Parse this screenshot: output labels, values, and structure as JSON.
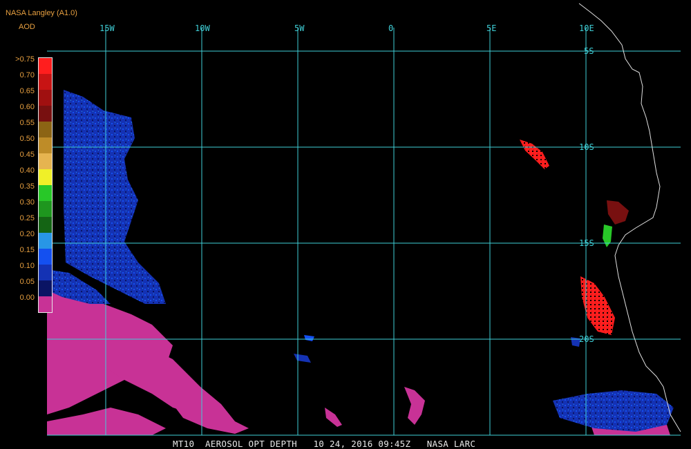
{
  "header": {
    "title": "NASA Langley (A1.0)",
    "subtitle": "AOD"
  },
  "legend": {
    "labels": [
      ">0.75",
      "0.70",
      "0.65",
      "0.60",
      "0.55",
      "0.50",
      "0.45",
      "0.40",
      "0.35",
      "0.30",
      "0.25",
      "0.20",
      "0.15",
      "0.10",
      "0.05",
      "0.00"
    ],
    "colors": [
      "#ff1e1e",
      "#c81414",
      "#a01010",
      "#781010",
      "#8c6414",
      "#be8c28",
      "#e6b450",
      "#f0f028",
      "#28c828",
      "#1e961e",
      "#146414",
      "#2896e6",
      "#1450f0",
      "#1432b4",
      "#0a1464",
      "#c83296"
    ]
  },
  "map": {
    "longitude_labels": [
      "15W",
      "10W",
      "5W",
      "0",
      "5E",
      "10E"
    ],
    "latitude_labels": [
      "5S",
      "10S",
      "15S",
      "20S"
    ],
    "grid_color": "#40d0d8",
    "coast_color": "#e0e0e0"
  },
  "footer": {
    "text": "MT10  AEROSOL OPT DEPTH   10 24, 2016 09:45Z   NASA LARC"
  }
}
